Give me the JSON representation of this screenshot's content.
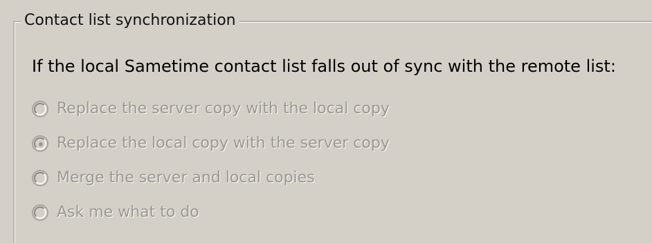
{
  "group": {
    "title": "Contact list synchronization",
    "prompt": "If the local Sametime contact list falls out of sync with the remote list:"
  },
  "options": [
    {
      "label": "Replace the server copy with the local copy",
      "selected": false
    },
    {
      "label": "Replace the local copy with the server copy",
      "selected": true
    },
    {
      "label": "Merge the server and local copies",
      "selected": false
    },
    {
      "label": "Ask me what to do",
      "selected": false
    }
  ],
  "state": {
    "enabled": false
  },
  "colors": {
    "background": "#d4d0c8",
    "disabled_text": "#9b9892",
    "text": "#000000"
  }
}
